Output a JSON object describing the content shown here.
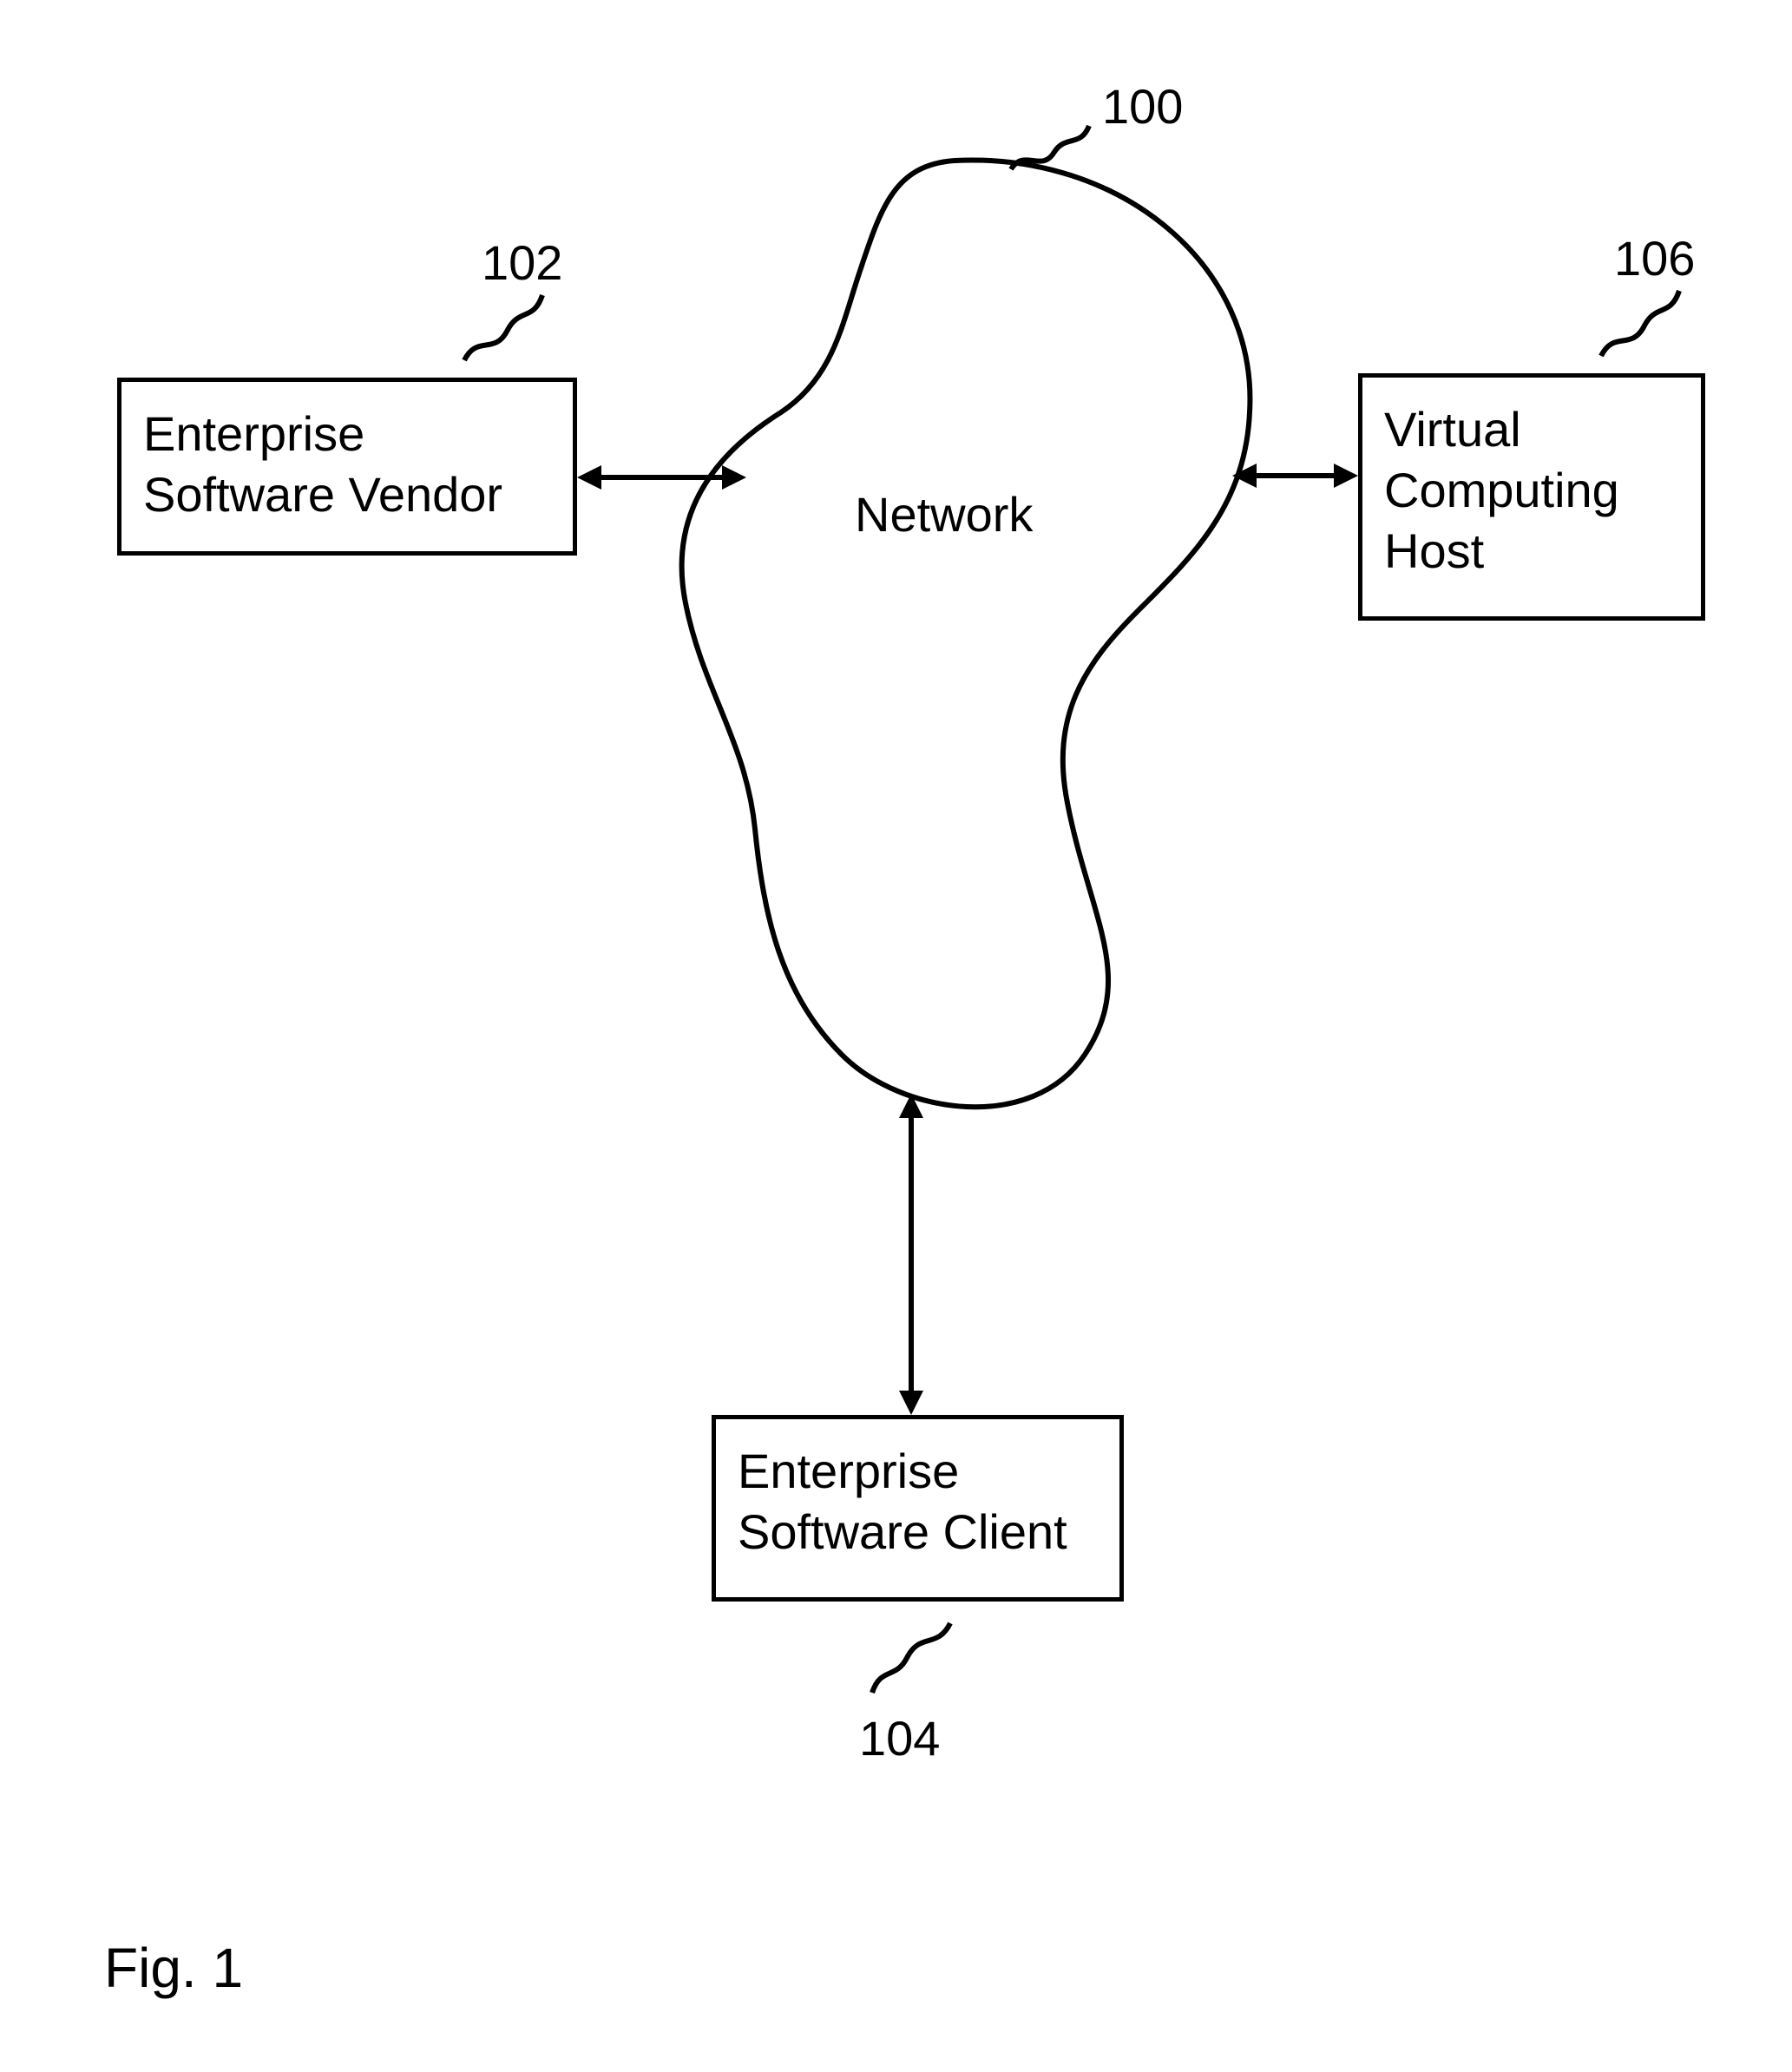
{
  "figure_label": "Fig. 1",
  "network_label": "Network",
  "refs": {
    "cloud": "100",
    "vendor": "102",
    "client": "104",
    "host": "106"
  },
  "boxes": {
    "vendor": "Enterprise\nSoftware Vendor",
    "client": "Enterprise\nSoftware Client",
    "host": "Virtual\nComputing\nHost"
  }
}
